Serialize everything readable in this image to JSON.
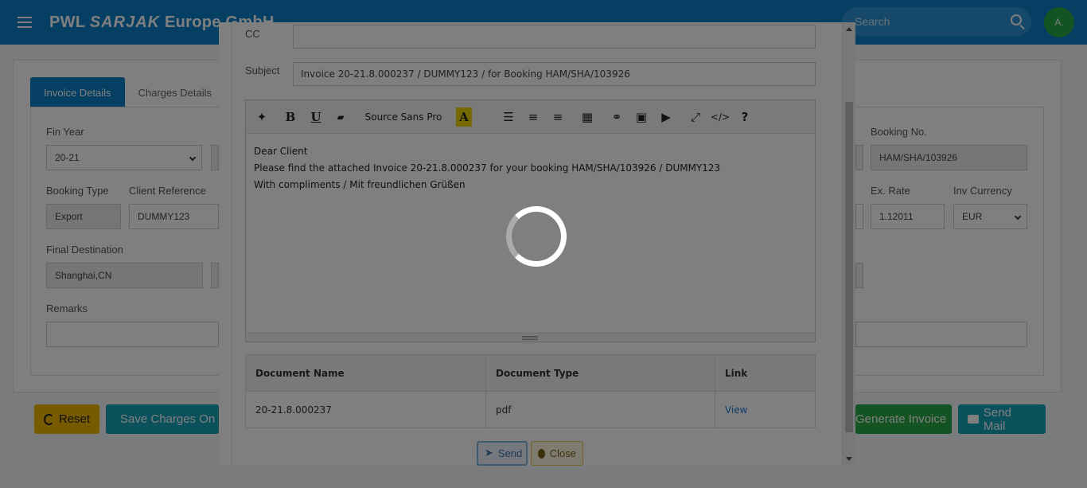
{
  "app": {
    "brand_prefix": "PWL ",
    "brand_mid": "SARJAK",
    "brand_suffix": " Europe GmbH",
    "search_placeholder": "Search",
    "avatar_initials": "A."
  },
  "tabs": [
    "Invoice Details",
    "Charges Details"
  ],
  "form": {
    "fin_year_label": "Fin Year",
    "fin_year_value": "20-21",
    "booking_no_label": "Booking No.",
    "booking_no_value": "HAM/SHA/103926",
    "booking_type_label": "Booking Type",
    "booking_type_value": "Export",
    "client_ref_label": "Client Reference",
    "client_ref_value": "DUMMY123",
    "ex_rate_label": "Ex. Rate",
    "ex_rate_value": "1.12011",
    "inv_currency_label": "Inv Currency",
    "inv_currency_value": "EUR",
    "final_dest_label": "Final Destination",
    "final_dest_value": "Shanghai,CN",
    "remarks_label": "Remarks"
  },
  "actions": {
    "reset": "Reset",
    "save_charges": "Save Charges On",
    "generate_invoice": "Generate Invoice",
    "send_mail": "Send Mail"
  },
  "modal": {
    "cc_label": "CC",
    "cc_value": "",
    "subject_label": "Subject",
    "subject_value": "Invoice 20-21.8.000237 / DUMMY123 / for Booking HAM/SHA/103926",
    "font_name": "Source Sans Pro",
    "body_lines": [
      "Dear Client",
      "Please find the attached Invoice 20-21.8.000237 for your booking HAM/SHA/103926 / DUMMY123",
      "With compliments / Mit freundlichen Grüßen"
    ],
    "table": {
      "headers": [
        "Document Name",
        "Document Type",
        "Link"
      ],
      "rows": [
        {
          "name": "20-21.8.000237",
          "type": "pdf",
          "link": "View"
        }
      ]
    },
    "send_label": "Send",
    "close_label": "Close"
  },
  "colors": {
    "primary": "#0b7fc7",
    "warning": "#f0b400",
    "success": "#28a745",
    "info": "#17a2b8"
  }
}
